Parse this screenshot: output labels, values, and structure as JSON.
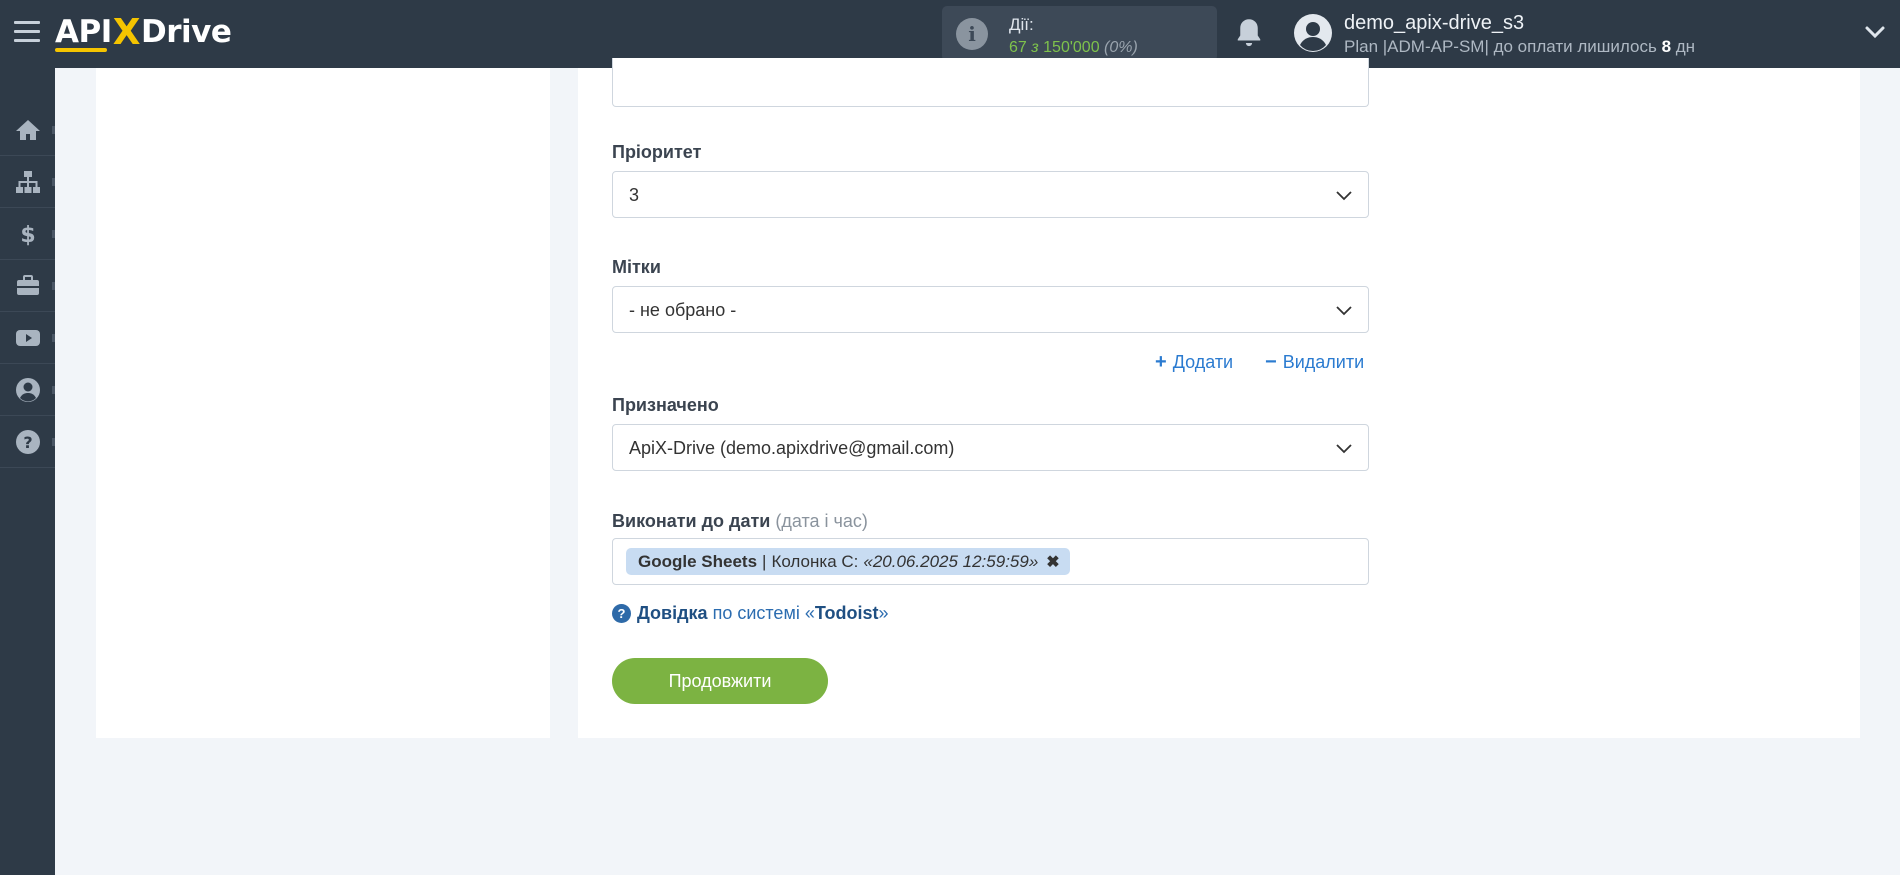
{
  "header": {
    "logo_left": "API",
    "logo_x": "X",
    "logo_right": "Drive",
    "actions_label": "Дії:",
    "actions_used": "67",
    "actions_of": "з",
    "actions_total": "150'000",
    "actions_pct": "(0%)",
    "user_name": "demo_apix-drive_s3",
    "plan_text": "Plan |ADM-AP-SM| до оплати лишилось",
    "plan_days": "8",
    "plan_days_unit": "дн"
  },
  "sidenav": {
    "items": [
      {
        "icon": "home-icon"
      },
      {
        "icon": "sitemap-icon"
      },
      {
        "icon": "dollar-icon"
      },
      {
        "icon": "briefcase-icon"
      },
      {
        "icon": "youtube-icon"
      },
      {
        "icon": "user-icon"
      },
      {
        "icon": "help-icon"
      }
    ]
  },
  "form": {
    "priority": {
      "label": "Пріоритет",
      "value": "3"
    },
    "labels": {
      "label": "Мітки",
      "value": "- не обрано -"
    },
    "add_label": "Додати",
    "remove_label": "Видалити",
    "assigned": {
      "label": "Призначено",
      "value": "ApiX-Drive (demo.apixdrive@gmail.com)"
    },
    "due": {
      "label": "Виконати до дати",
      "hint": "(дата і час)",
      "tag_source": "Google Sheets",
      "tag_separator": "|",
      "tag_column": "Колонка C:",
      "tag_value": "«20.06.2025 12:59:59»"
    },
    "help_word": "Довідка",
    "help_mid": "по системі «",
    "help_system": "Todoist",
    "help_end": "»",
    "continue_label": "Продовжити"
  },
  "colors": {
    "topbar": "#2e3a47",
    "accent_green": "#7cb342",
    "link_blue": "#2b7bd0",
    "tag_bg": "#c8dcf2",
    "logo_yellow": "#f5c400"
  }
}
